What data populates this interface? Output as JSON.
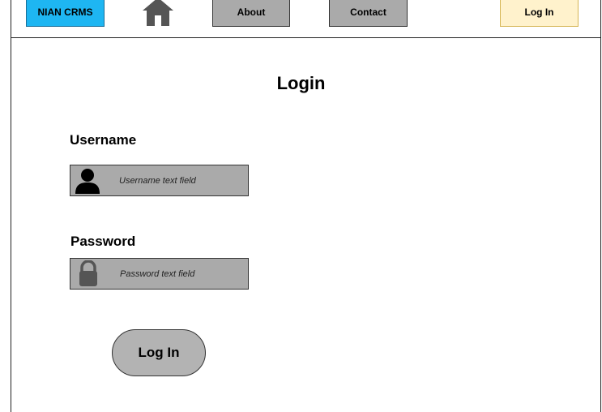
{
  "nav": {
    "brand_label": "NIAN CRMS",
    "about_label": "About",
    "contact_label": "Contact",
    "login_label": "Log In",
    "home_icon": "home-icon"
  },
  "form": {
    "title": "Login",
    "username_label": "Username",
    "username_placeholder": "Username text field",
    "user_icon": "user-icon",
    "password_label": "Password",
    "password_placeholder": "Password text field",
    "lock_icon": "lock-icon",
    "submit_label": "Log In"
  },
  "colors": {
    "brand_bg": "#1eb6f2",
    "nav_bg": "#aaaaaa",
    "login_bg": "#fff2cc",
    "field_bg": "#aaaaaa",
    "icon": "#555555"
  }
}
